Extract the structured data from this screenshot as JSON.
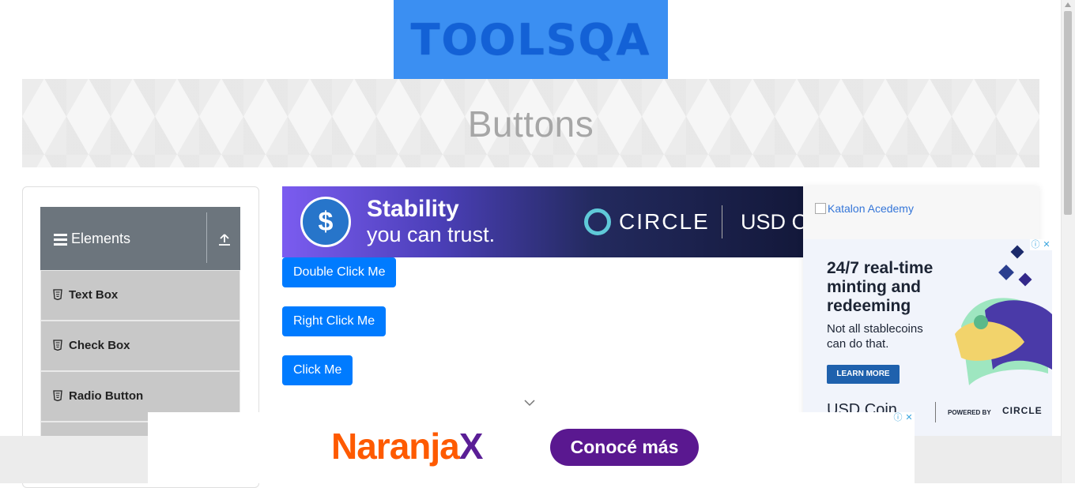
{
  "header": {
    "logo_text": "TOOLSQA"
  },
  "banner": {
    "title": "Buttons"
  },
  "sidebar": {
    "group_title": "Elements",
    "items": [
      {
        "label": "Text Box"
      },
      {
        "label": "Check Box"
      },
      {
        "label": "Radio Button"
      }
    ]
  },
  "top_ad": {
    "headline": "Stability",
    "subline": "you can trust.",
    "brand": "CIRCLE",
    "product": "USD Co"
  },
  "buttons": {
    "double_click": "Double Click Me",
    "right_click": "Right Click Me",
    "click": "Click Me"
  },
  "right_ad": {
    "broken_image_alt": "Katalon Acedemy",
    "headline": "24/7 real-time minting and redeeming",
    "body": "Not all stablecoins can do that.",
    "cta": "LEARN MORE",
    "footer_product": "USD Coin",
    "footer_powered": "POWERED BY",
    "footer_brand": "CIRCLE"
  },
  "bottom_ad": {
    "brand_main": "Naranja",
    "brand_x": "X",
    "cta": "Conocé más"
  },
  "colors": {
    "primary_button": "#007bff",
    "sidebar_header": "#6c757d",
    "sidebar_item": "#c8c8c8",
    "logo_bg": "#3b8ff2",
    "naranja_orange": "#fe5a00",
    "naranja_purple": "#5a1890"
  }
}
